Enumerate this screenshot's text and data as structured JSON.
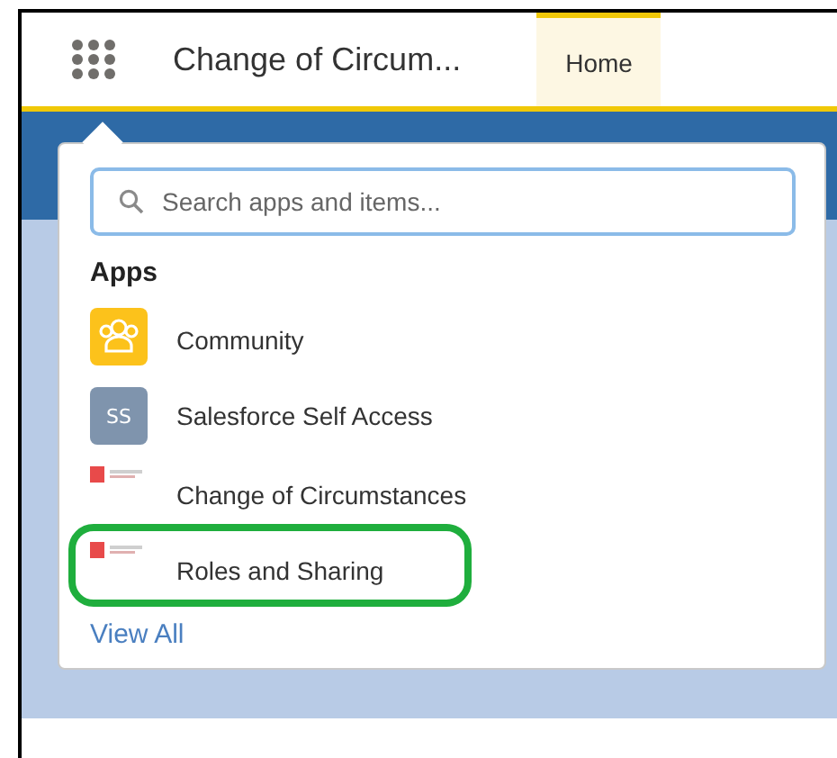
{
  "header": {
    "app_name": "Change of Circum...",
    "tabs": [
      {
        "label": "Home",
        "selected": true
      }
    ]
  },
  "launcher": {
    "search": {
      "placeholder": "Search apps and items..."
    },
    "section_title": "Apps",
    "apps": [
      {
        "name": "Community",
        "icon": {
          "kind": "community"
        },
        "highlighted": false
      },
      {
        "name": "Salesforce Self Access",
        "icon": {
          "kind": "initials",
          "text": "SS"
        },
        "highlighted": false
      },
      {
        "name": "Change of Circumstances",
        "icon": {
          "kind": "logo"
        },
        "highlighted": false
      },
      {
        "name": "Roles and Sharing",
        "icon": {
          "kind": "logo"
        },
        "highlighted": true
      }
    ],
    "view_all": "View All"
  }
}
